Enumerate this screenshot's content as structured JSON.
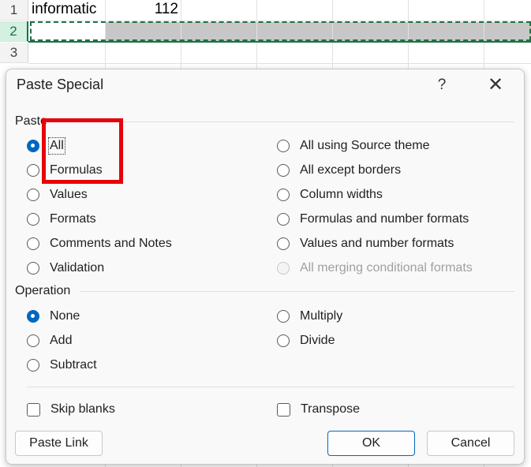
{
  "sheet": {
    "rows": [
      {
        "num": "1",
        "a": "informatic",
        "b": "112"
      },
      {
        "num": "2"
      },
      {
        "num": "3"
      }
    ]
  },
  "dialog": {
    "title": "Paste Special",
    "help": "?",
    "close": "✕",
    "paste_section": "Paste",
    "paste_left": [
      "All",
      "Formulas",
      "Values",
      "Formats",
      "Comments and Notes",
      "Validation"
    ],
    "paste_right": [
      "All using Source theme",
      "All except borders",
      "Column widths",
      "Formulas and number formats",
      "Values and number formats",
      "All merging conditional formats"
    ],
    "operation_section": "Operation",
    "operation_left": [
      "None",
      "Add",
      "Subtract"
    ],
    "operation_right": [
      "Multiply",
      "Divide"
    ],
    "skip_blanks": "Skip blanks",
    "transpose": "Transpose",
    "paste_link": "Paste Link",
    "ok": "OK",
    "cancel": "Cancel"
  },
  "colors": {
    "accent": "#0067c0",
    "highlight": "#e8000b",
    "selection_green": "#1e7145"
  }
}
